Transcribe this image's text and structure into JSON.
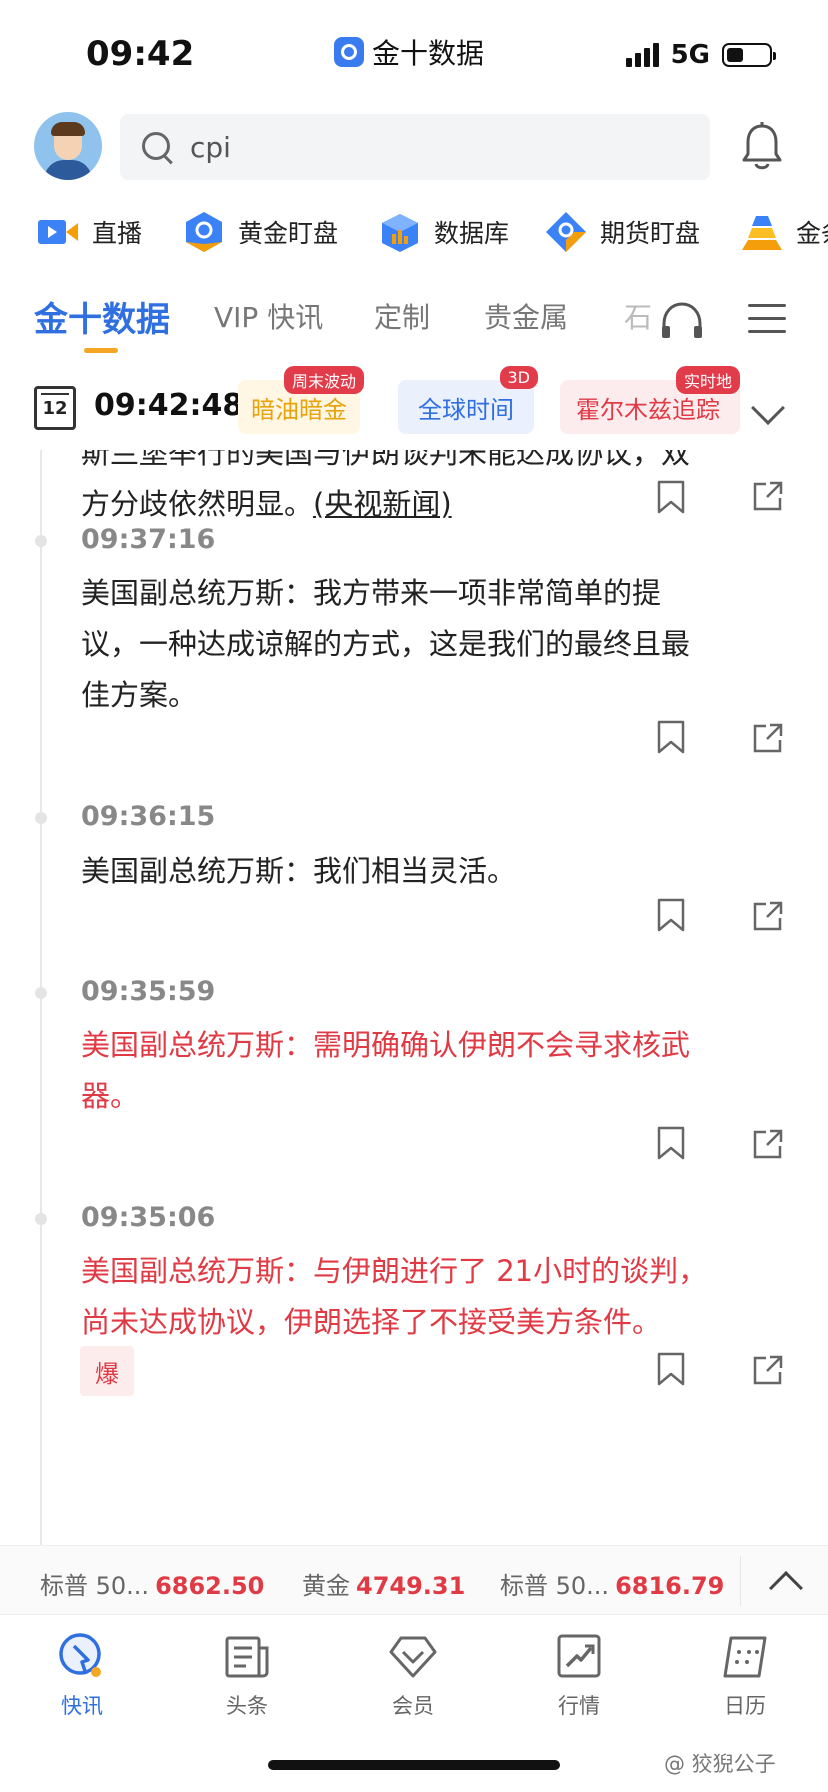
{
  "status_bar": {
    "time": "09:42",
    "app_name": "金十数据",
    "network": "5G"
  },
  "header": {
    "search_value": "cpi"
  },
  "quick_nav": [
    {
      "label": "直播",
      "icon": "live-video-icon"
    },
    {
      "label": "黄金盯盘",
      "icon": "gold-watch-icon"
    },
    {
      "label": "数据库",
      "icon": "database-icon"
    },
    {
      "label": "期货盯盘",
      "icon": "futures-watch-icon"
    },
    {
      "label": "金条",
      "icon": "gold-bar-icon"
    }
  ],
  "tabs": [
    {
      "label": "金十数据",
      "active": true
    },
    {
      "label": "VIP 快讯"
    },
    {
      "label": "定制"
    },
    {
      "label": "贵金属"
    },
    {
      "label": "石"
    }
  ],
  "timer_row": {
    "calendar_day": "12",
    "clock": "09:42:48",
    "chips": [
      {
        "label": "暗油暗金",
        "badge": "周末波动",
        "color": "#e8a20c",
        "bg": "#fff6e3"
      },
      {
        "label": "全球时间",
        "badge": "3D",
        "color": "#2f6fe0",
        "bg": "#eaf1fd"
      },
      {
        "label": "霍尔木兹追踪",
        "badge": "实时地",
        "color": "#e03a45",
        "bg": "#fdecee"
      }
    ]
  },
  "feed": {
    "partial_item": {
      "text_line1": "斯兰堡举行的美国与伊朗谈判未能达成协议，双",
      "text_line2": "方分歧依然明显。",
      "source": "(央视新闻)"
    },
    "items": [
      {
        "time": "09:37:16",
        "lines": [
          "美国副总统万斯：我方带来一项非常简单的提",
          "议，一种达成谅解的方式，这是我们的最终且最",
          "佳方案。"
        ],
        "important": false
      },
      {
        "time": "09:36:15",
        "lines": [
          "美国副总统万斯：我们相当灵活。"
        ],
        "important": false
      },
      {
        "time": "09:35:59",
        "lines": [
          "美国副总统万斯：需明确确认伊朗不会寻求核武",
          "器。"
        ],
        "important": true
      },
      {
        "time": "09:35:06",
        "lines": [
          "美国副总统万斯：与伊朗进行了 21小时的谈判，",
          "尚未达成协议，伊朗选择了不接受美方条件。"
        ],
        "important": true,
        "tag": "爆"
      }
    ]
  },
  "ticker": [
    {
      "name": "标普 50...",
      "value": "6862.50"
    },
    {
      "name": "黄金",
      "value": "4749.31"
    },
    {
      "name": "标普 50...",
      "value": "6816.79"
    }
  ],
  "bottom_nav": [
    {
      "label": "快讯",
      "active": true
    },
    {
      "label": "头条"
    },
    {
      "label": "会员"
    },
    {
      "label": "行情"
    },
    {
      "label": "日历"
    }
  ],
  "watermark": "@ 狡猊公子",
  "colors": {
    "accent": "#2f6fe0",
    "important": "#e03a45",
    "tab_underline": "#f5a623"
  }
}
